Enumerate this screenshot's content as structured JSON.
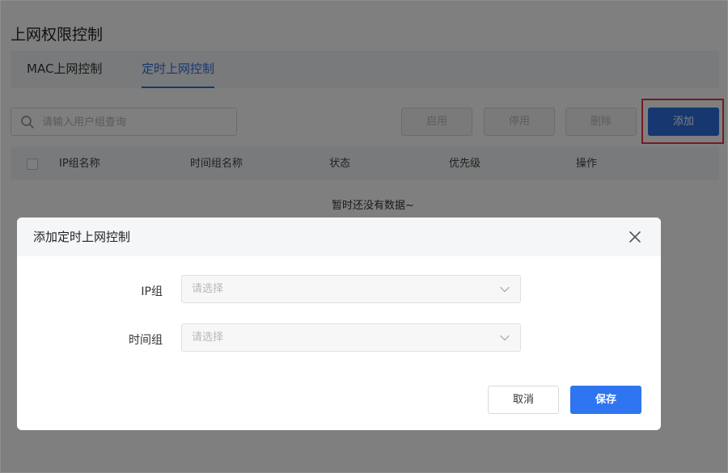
{
  "page": {
    "title": "上网权限控制"
  },
  "tabs": [
    {
      "label": "MAC上网控制",
      "active": false
    },
    {
      "label": "定时上网控制",
      "active": true
    }
  ],
  "toolbar": {
    "search_placeholder": "请输入用户组查询",
    "enable_label": "启用",
    "disable_label": "停用",
    "delete_label": "删除",
    "add_label": "添加"
  },
  "table": {
    "columns": [
      "IP组名称",
      "时间组名称",
      "状态",
      "优先级",
      "操作"
    ],
    "rows": [],
    "empty_text": "暂时还没有数据~"
  },
  "dialog": {
    "title": "添加定时上网控制",
    "fields": [
      {
        "label": "IP组",
        "placeholder": "请选择"
      },
      {
        "label": "时间组",
        "placeholder": "请选择"
      }
    ],
    "cancel_label": "取消",
    "save_label": "保存"
  },
  "icons": {
    "search": "search-icon",
    "close": "close-icon",
    "dropdown": "chevron-down-icon"
  },
  "colors": {
    "primary": "#2f6fe0",
    "highlight": "#e8384d",
    "disabled_text": "#b8b8b8"
  }
}
